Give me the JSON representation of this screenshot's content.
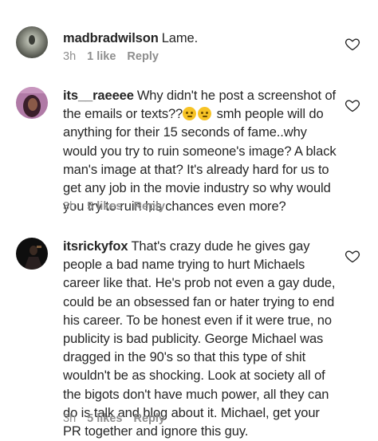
{
  "comments": [
    {
      "username": "madbradwilson",
      "text": "Lame.",
      "time": "3h",
      "likes": "1 like",
      "reply": "Reply",
      "avatar_color": "#7a7c72"
    },
    {
      "username": "its__raeeee",
      "text_before_emoji": "Why didn't he post a screenshot of the emails or texts??",
      "emoji": [
        "thinking-face-icon",
        "thinking-face-icon"
      ],
      "text_after_emoji": " smh people will do anything for their 15 seconds of fame..why would you try to ruin someone's image? A black man's image at that? It's already hard for us to get any job in the movie industry so why would you try to ruin his chances even more?",
      "time": "3h",
      "likes": "5 likes",
      "reply": "Reply",
      "avatar_color": "#9a5a8a"
    },
    {
      "username": "itsrickyfox",
      "text": "That's crazy dude he gives gay people a bad name trying to hurt Michaels career like that. He's prob not even a gay dude, could be an obsessed fan or hater trying to end his career. To be honest even if it were true, no publicity is bad publicity. George Michael was dragged in the 90's so that this type of shit wouldn't be as shocking. Look at society all of the bigots don't have much power, all they can do is talk and blog about it. Michael, get your PR together and ignore this guy.",
      "time": "3h",
      "likes": "5 likes",
      "reply": "Reply",
      "avatar_color": "#1a1a1a"
    }
  ],
  "colors": {
    "text": "#262626",
    "meta": "#8e8e8e",
    "heart_stroke": "#262626"
  }
}
